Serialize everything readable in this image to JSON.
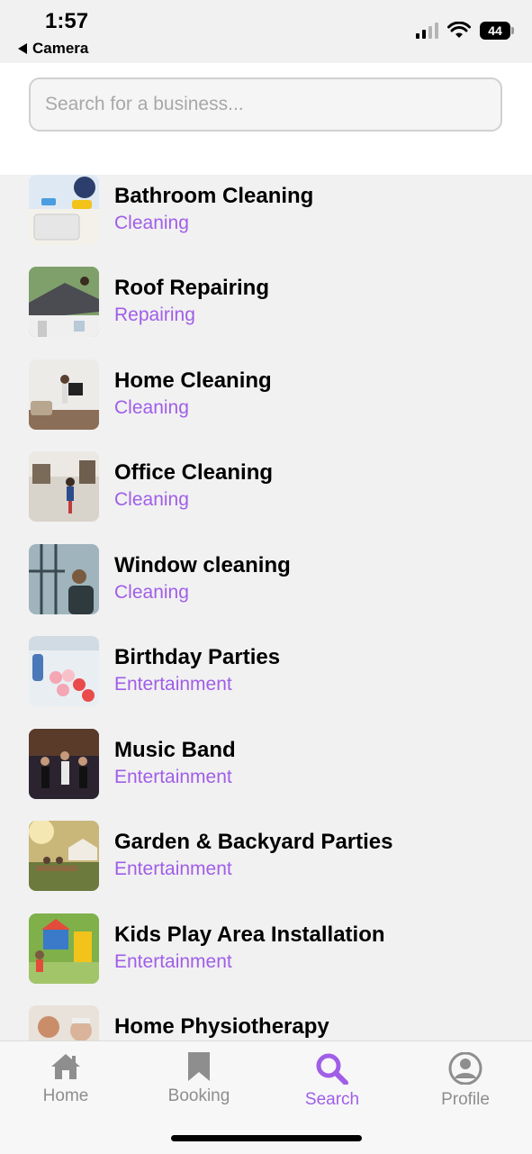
{
  "status_bar": {
    "time": "1:57",
    "back_label": "Camera",
    "battery": "44"
  },
  "search": {
    "placeholder": "Search for a business...",
    "value": ""
  },
  "businesses": [
    {
      "title": "Bathroom Cleaning",
      "category": "Cleaning"
    },
    {
      "title": "Roof Repairing",
      "category": "Repairing"
    },
    {
      "title": "Home Cleaning",
      "category": "Cleaning"
    },
    {
      "title": "Office Cleaning",
      "category": "Cleaning"
    },
    {
      "title": "Window cleaning",
      "category": "Cleaning"
    },
    {
      "title": "Birthday Parties",
      "category": "Entertainment"
    },
    {
      "title": "Music Band",
      "category": "Entertainment"
    },
    {
      "title": "Garden & Backyard Parties",
      "category": "Entertainment"
    },
    {
      "title": "Kids Play Area Installation",
      "category": "Entertainment"
    },
    {
      "title": "Home Physiotherapy",
      "category": ""
    }
  ],
  "tabs": [
    {
      "label": "Home",
      "icon": "home-icon",
      "active": false
    },
    {
      "label": "Booking",
      "icon": "bookmark-icon",
      "active": false
    },
    {
      "label": "Search",
      "icon": "search-icon",
      "active": true
    },
    {
      "label": "Profile",
      "icon": "profile-icon",
      "active": false
    }
  ],
  "colors": {
    "accent": "#a05ee8",
    "inactive": "#8e8e8e",
    "background": "#f1f1f1"
  }
}
